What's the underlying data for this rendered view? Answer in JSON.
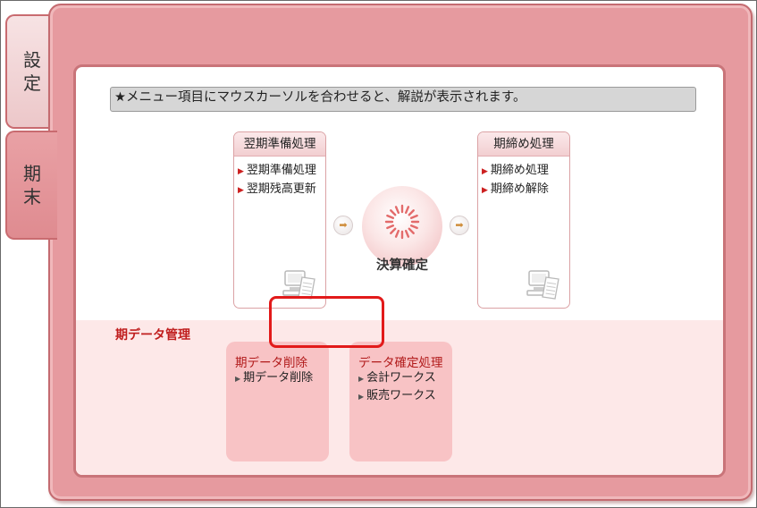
{
  "tabs": [
    {
      "chars": [
        "設",
        "定"
      ]
    },
    {
      "chars": [
        "期",
        "末"
      ]
    }
  ],
  "notice": "★メニュー項目にマウスカーソルを合わせると、解説が表示されます。",
  "cards": [
    {
      "title": "翌期準備処理",
      "items": [
        "翌期準備処理",
        "翌期残高更新"
      ]
    },
    {
      "title": "期締め処理",
      "items": [
        "期締め処理",
        "期締め解除"
      ]
    }
  ],
  "center": {
    "label": "決算確定"
  },
  "mgmt": {
    "title": "期データ管理",
    "cards": [
      {
        "title": "期データ削除",
        "items": [
          "期データ削除"
        ]
      },
      {
        "title": "データ確定処理",
        "items": [
          "会計ワークス",
          "販売ワークス"
        ]
      }
    ]
  },
  "colors": {
    "accent": "#e69a9f",
    "highlight": "#e21a1a",
    "link_marker": "#cc2020"
  },
  "icons": {
    "arrow": "right-arrow-icon",
    "center": "sunburst-icon",
    "card": "computer-document-icon"
  }
}
